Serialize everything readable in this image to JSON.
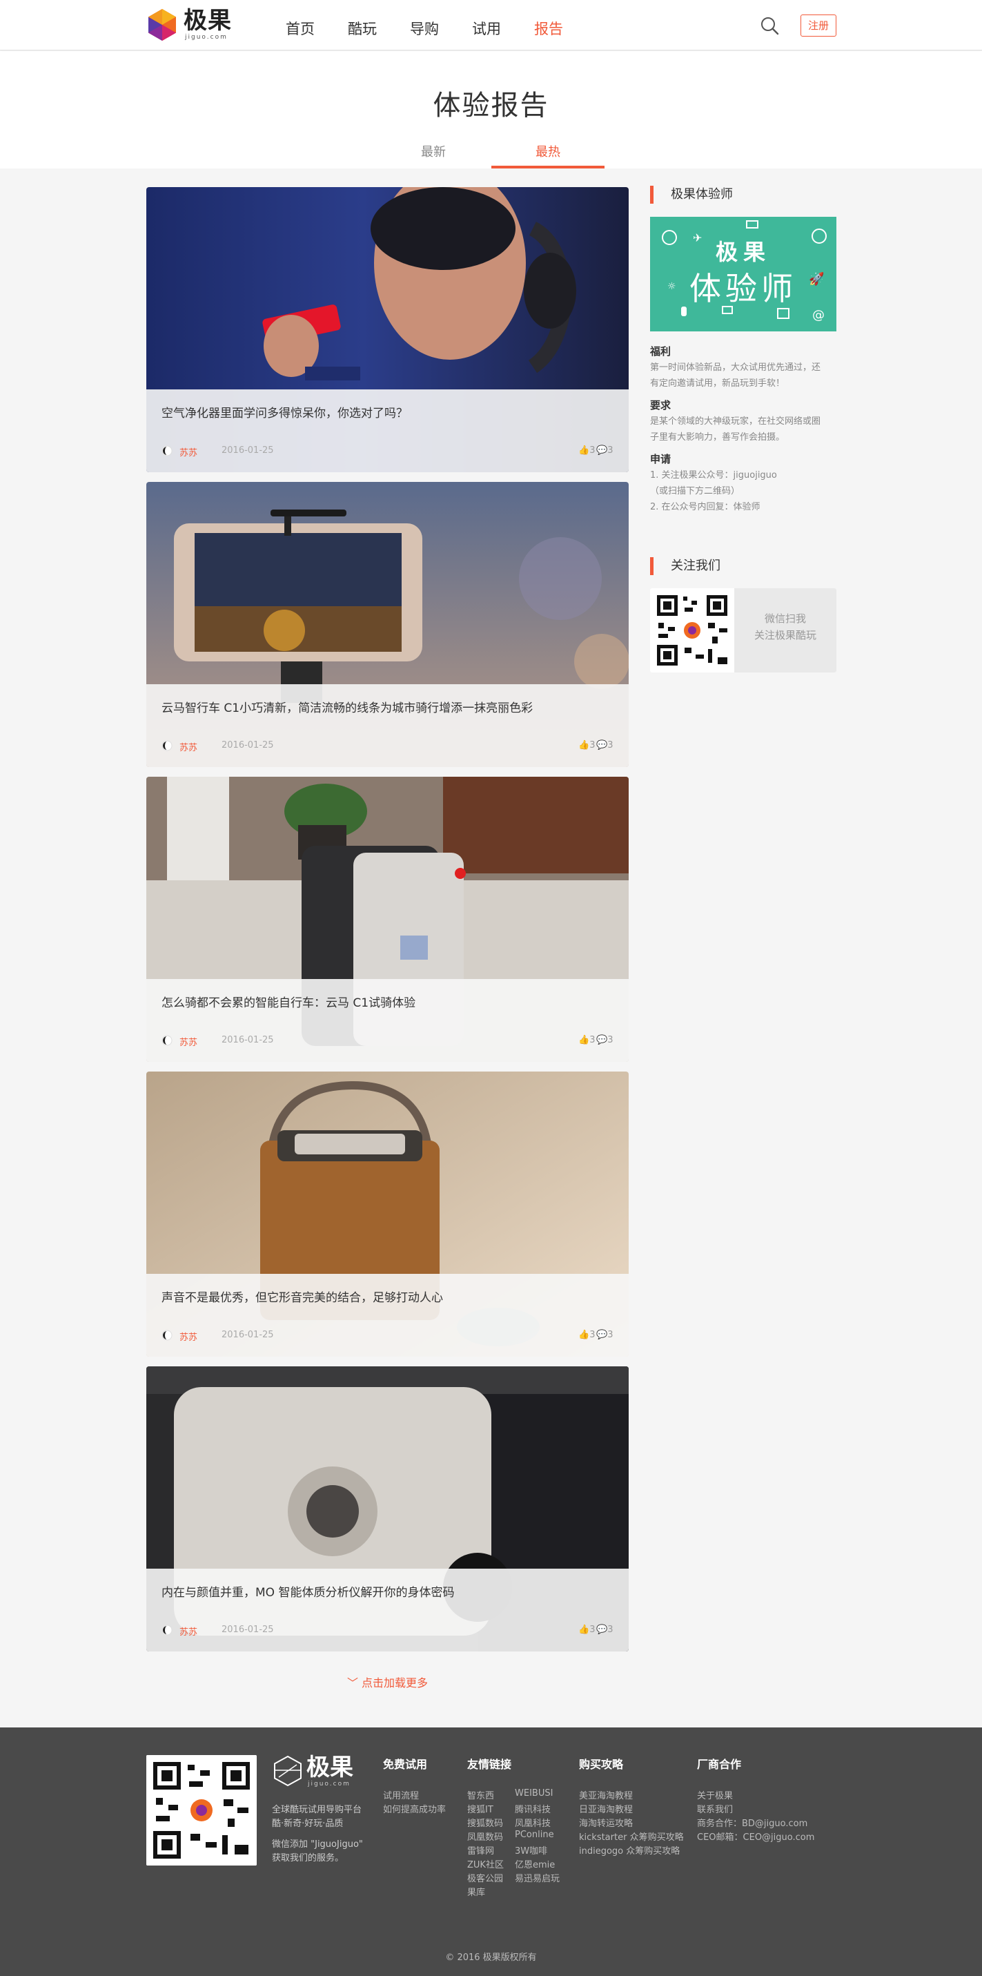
{
  "header": {
    "logo_text": "极果",
    "logo_sub": "jiguo.com",
    "nav": [
      {
        "label": "首页",
        "active": false
      },
      {
        "label": "酷玩",
        "active": false
      },
      {
        "label": "导购",
        "active": false
      },
      {
        "label": "试用",
        "active": false
      },
      {
        "label": "报告",
        "active": true
      }
    ],
    "register_label": "注册"
  },
  "page": {
    "title": "体验报告",
    "tabs": [
      {
        "label": "最新",
        "active": false
      },
      {
        "label": "最热",
        "active": true
      }
    ]
  },
  "articles": [
    {
      "title": "空气净化器里面学问多得惊呆你，你选对了吗？",
      "author": "苏苏",
      "date": "2016-01-25",
      "likes": "3",
      "comments": "3"
    },
    {
      "title": "云马智行车 C1小巧清新，简洁流畅的线条为城市骑行增添一抹亮丽色彩",
      "author": "苏苏",
      "date": "2016-01-25",
      "likes": "3",
      "comments": "3"
    },
    {
      "title": "怎么骑都不会累的智能自行车：云马 C1试骑体验",
      "author": "苏苏",
      "date": "2016-01-25",
      "likes": "3",
      "comments": "3"
    },
    {
      "title": "声音不是最优秀，但它形音完美的结合，足够打动人心",
      "author": "苏苏",
      "date": "2016-01-25",
      "likes": "3",
      "comments": "3"
    },
    {
      "title": "内在与颜值并重，MO 智能体质分析仪解开你的身体密码",
      "author": "苏苏",
      "date": "2016-01-25",
      "likes": "3",
      "comments": "3"
    }
  ],
  "load_more": "点击加载更多",
  "sidebar": {
    "experiencer_title": "极果体验师",
    "banner_line1": "极果",
    "banner_line2": "体验师",
    "perks": [
      {
        "heading": "福利",
        "lines": [
          "第一时间体验新品，大众试用优先通过，还",
          "有定向邀请试用，新品玩到手软！"
        ]
      },
      {
        "heading": "要求",
        "lines": [
          "是某个领域的大神级玩家，在社交网络或圈",
          "子里有大影响力，善写作会拍摄。"
        ]
      },
      {
        "heading": "申请",
        "lines": [
          "1. 关注极果公众号：jiguojiguo",
          "（或扫描下方二维码）",
          "2. 在公众号内回复：体验师"
        ]
      }
    ],
    "follow_title": "关注我们",
    "follow_line1": "微信扫我",
    "follow_line2": "关注极果酷玩"
  },
  "footer": {
    "logo_text": "极果",
    "logo_sub": "jiguo.com",
    "slogan_line1": "全球酷玩试用导购平台",
    "slogan_line2": "酷·新奇·好玩·品质",
    "wechat_line1": "微信添加 \"JiguoJiguo\"",
    "wechat_line2": "获取我们的服务。",
    "columns": [
      {
        "title": "免费试用",
        "links": [
          "试用流程",
          "如何提高成功率"
        ]
      },
      {
        "title": "友情链接",
        "links": [
          "智东西",
          "WEIBUSI",
          "搜狐IT",
          "腾讯科技",
          "搜狐数码",
          "凤凰科技",
          "凤凰数码",
          "PConline",
          "雷锋网",
          "3W咖啡",
          "ZUK社区",
          "亿恩emie",
          "极客公园",
          "易迅易启玩",
          "果库"
        ]
      },
      {
        "title": "购买攻略",
        "links": [
          "美亚海淘教程",
          "日亚海淘教程",
          "海淘转运攻略",
          "kickstarter 众筹购买攻略",
          "indiegogo 众筹购买攻略"
        ]
      },
      {
        "title": "厂商合作",
        "links": [
          "关于极果",
          "联系我们",
          "商务合作：BD@jiguo.com",
          "CEO邮箱：CEO@jiguo.com"
        ]
      }
    ],
    "copyright": "© 2016 极果版权所有"
  }
}
